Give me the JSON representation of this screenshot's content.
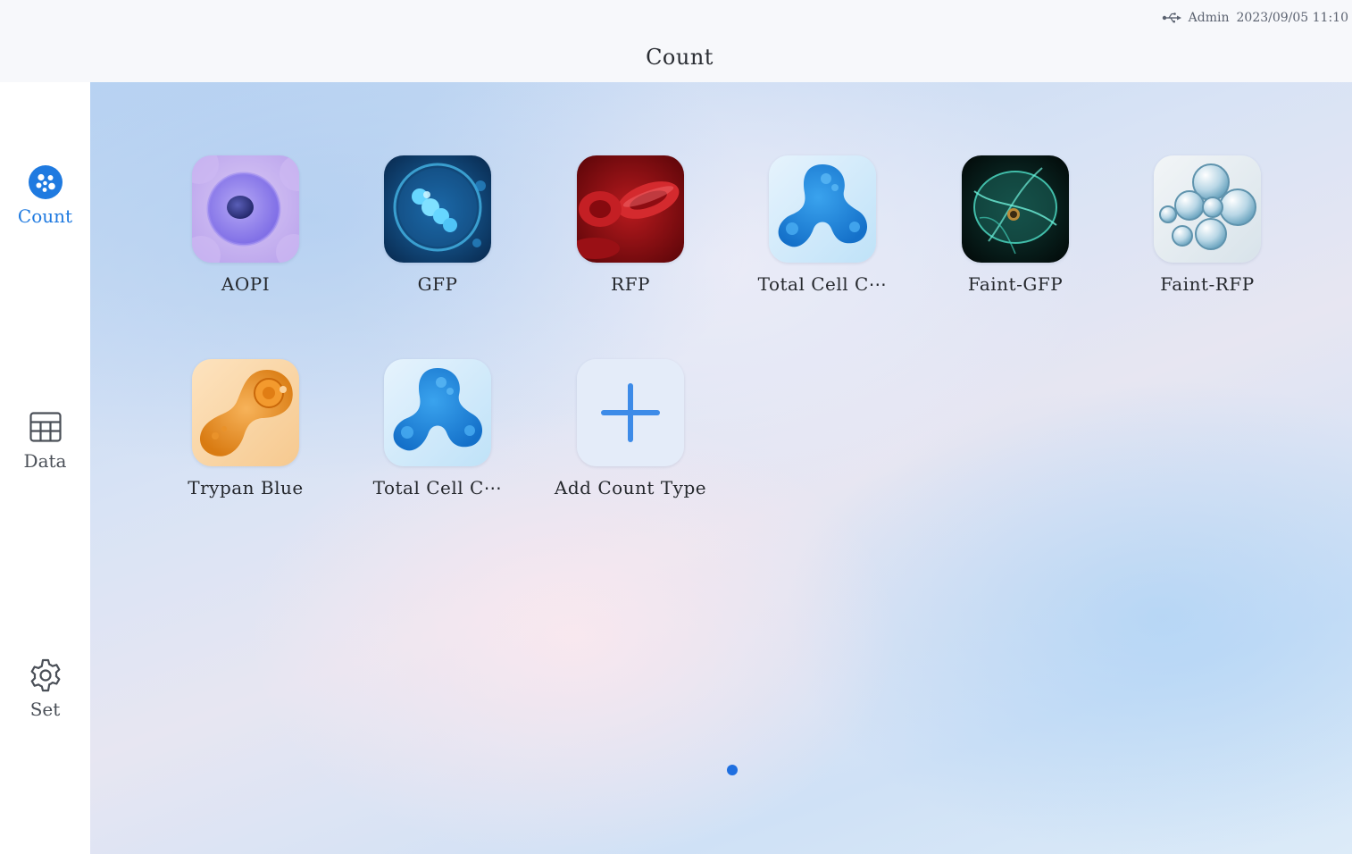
{
  "status_bar": {
    "icon": "usb-icon",
    "user": "Admin",
    "datetime": "2023/09/05 11:10"
  },
  "header": {
    "title": "Count"
  },
  "sidebar": {
    "items": [
      {
        "label": "Count",
        "icon": "count-icon",
        "active": true
      },
      {
        "label": "Data",
        "icon": "table-icon",
        "active": false
      },
      {
        "label": "Set",
        "icon": "gear-icon",
        "active": false
      }
    ]
  },
  "apps": [
    {
      "label": "AOPI",
      "icon": "aopi-cell-icon"
    },
    {
      "label": "GFP",
      "icon": "gfp-cell-icon"
    },
    {
      "label": "RFP",
      "icon": "rfp-blood-cell-icon"
    },
    {
      "label": "Total Cell C⋯",
      "icon": "total-cell-count-icon"
    },
    {
      "label": "Faint-GFP",
      "icon": "faint-gfp-icon"
    },
    {
      "label": "Faint-RFP",
      "icon": "faint-rfp-bubbles-icon"
    },
    {
      "label": "Trypan Blue",
      "icon": "trypan-blue-icon"
    },
    {
      "label": "Total Cell C⋯",
      "icon": "total-cell-count-icon"
    },
    {
      "label": "Add Count Type",
      "icon": "plus-icon"
    }
  ],
  "pagination": {
    "current_page": 1,
    "total_pages": 1
  },
  "colors": {
    "accent": "#1f7ae0",
    "page_dot": "#1f6fe0"
  }
}
